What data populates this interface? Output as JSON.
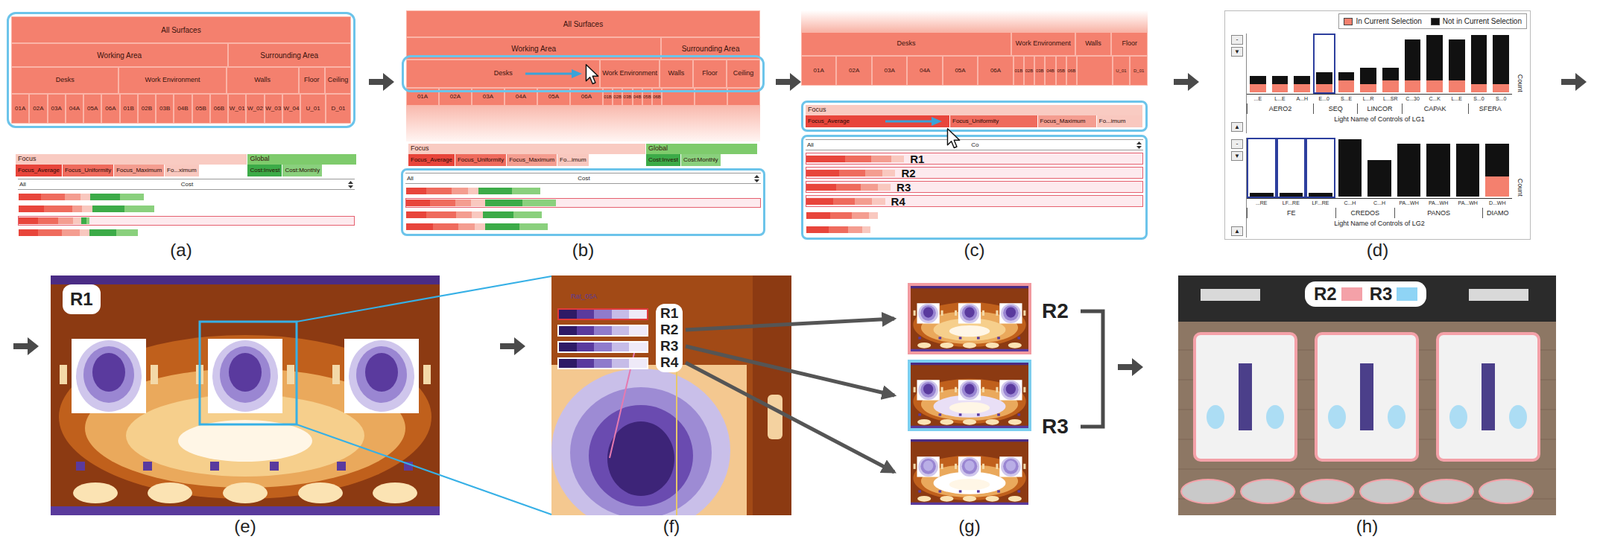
{
  "panel_labels": [
    "(a)",
    "(b)",
    "(c)",
    "(d)",
    "(e)",
    "(f)",
    "(g)",
    "(h)"
  ],
  "panel_a": {
    "treemap": {
      "highlighted_row": "all",
      "root": "All Surfaces",
      "groups": [
        {
          "name": "Working Area",
          "subgroups": [
            {
              "name": "Desks",
              "expanded": true,
              "leaves": [
                "01A",
                "02A",
                "03A",
                "04A",
                "05A",
                "06A"
              ]
            },
            {
              "name": "Work Environment",
              "expanded": true,
              "leaves": [
                "01B",
                "02B",
                "03B",
                "04B",
                "05B",
                "06B"
              ]
            }
          ]
        },
        {
          "name": "Surrounding Area",
          "subgroups": [
            {
              "name": "Walls",
              "expanded": true,
              "leaves": [
                "W_01",
                "W_02",
                "W_03",
                "W_04"
              ]
            },
            {
              "name": "Floor",
              "expanded": true,
              "leaves": [
                "U_01"
              ]
            },
            {
              "name": "Ceiling",
              "expanded": true,
              "leaves": [
                "D_01"
              ]
            }
          ]
        }
      ]
    },
    "criteria": {
      "highlighted": false,
      "groups": [
        {
          "title": "Focus",
          "color": "#f9cbc2",
          "items": [
            {
              "label": "Focus_Average",
              "weight": 0.19,
              "color": "#e8453b"
            },
            {
              "label": "Focus_Uniformity",
              "weight": 0.24,
              "color": "#ef6b5d"
            },
            {
              "label": "Focus_Maximum",
              "weight": 0.15,
              "color": "#f49d90"
            },
            {
              "label": "Fo...ximum",
              "weight": 0.1,
              "color": "#f9c8bf"
            }
          ]
        },
        {
          "title": "Global",
          "color": "#7ecb6c",
          "items": [
            {
              "label": "Cost:Invest",
              "weight": 0.16,
              "color": "#3cab48"
            },
            {
              "label": "Cost:Monthly",
              "weight": 0.16,
              "color": "#8ad07d"
            }
          ]
        }
      ]
    },
    "column_header": {
      "all": "All",
      "sort": "Cost"
    },
    "rows_highlighted": false,
    "rows": [
      {
        "values": [
          0.35,
          0.3,
          0.3,
          0.3,
          0.55,
          0.45
        ],
        "selected": false
      },
      {
        "values": [
          0.4,
          0.35,
          0.2,
          0.3,
          0.6,
          0.55
        ],
        "selected": false
      },
      {
        "values": [
          0.3,
          0.25,
          0.3,
          0.25,
          0.1,
          0.05
        ],
        "selected": true
      },
      {
        "values": [
          0.3,
          0.3,
          0.35,
          0.3,
          0.5,
          0.4
        ],
        "selected": false
      }
    ]
  },
  "panel_b": {
    "treemap": {
      "highlighted_row": "subgroups",
      "root": "All Surfaces",
      "groups": [
        {
          "name": "Working Area",
          "subgroups": [
            {
              "name": "Desks",
              "expanded": true,
              "leaves": [
                "01A",
                "02A",
                "03A",
                "04A",
                "05A",
                "06A"
              ]
            },
            {
              "name": "Work Environment",
              "expanded": false,
              "leaves": [
                "01B",
                "02B",
                "03B",
                "04B",
                "05B",
                "06B"
              ]
            }
          ]
        },
        {
          "name": "Surrounding Area",
          "subgroups": [
            {
              "name": "Walls",
              "expanded": false,
              "leaves": []
            },
            {
              "name": "Floor",
              "expanded": false,
              "leaves": []
            },
            {
              "name": "Ceiling",
              "expanded": false,
              "leaves": []
            }
          ]
        }
      ]
    },
    "criteria": {
      "highlighted": false,
      "groups": [
        {
          "title": "Focus",
          "color": "#f9cbc2",
          "items": [
            {
              "label": "Focus_Average",
              "weight": 0.19,
              "color": "#e8453b"
            },
            {
              "label": "Focus_Uniformity",
              "weight": 0.24,
              "color": "#ef6b5d"
            },
            {
              "label": "Focus_Maximum",
              "weight": 0.15,
              "color": "#f49d90"
            },
            {
              "label": "Fo...imum",
              "weight": 0.1,
              "color": "#f9c8bf"
            }
          ]
        },
        {
          "title": "Global",
          "color": "#7ecb6c",
          "items": [
            {
              "label": "Cost:Invest",
              "weight": 0.16,
              "color": "#3cab48"
            },
            {
              "label": "Cost:Monthly",
              "weight": 0.16,
              "color": "#8ad07d"
            }
          ]
        }
      ]
    },
    "column_header": {
      "all": "All",
      "sort": "Cost"
    },
    "rows_highlighted": true,
    "rows": [
      {
        "values": [
          0.3,
          0.3,
          0.3,
          0.3,
          0.6,
          0.5
        ],
        "selected": false
      },
      {
        "values": [
          0.35,
          0.3,
          0.3,
          0.4,
          0.65,
          0.6
        ],
        "selected": true
      },
      {
        "values": [
          0.3,
          0.35,
          0.3,
          0.3,
          0.55,
          0.5
        ],
        "selected": false
      },
      {
        "values": [
          0.4,
          0.3,
          0.3,
          0.3,
          0.6,
          0.5
        ],
        "selected": false
      }
    ]
  },
  "panel_c": {
    "treemap": {
      "highlighted_row": "none",
      "subgroups": [
        {
          "name": "Desks",
          "expanded": true,
          "leaves": [
            "01A",
            "02A",
            "03A",
            "04A",
            "05A",
            "06A"
          ]
        },
        {
          "name": "Work Environment",
          "expanded": false,
          "leaves": [
            "01B",
            "02B",
            "03B",
            "04B",
            "05B",
            "06B"
          ]
        },
        {
          "name": "Walls",
          "expanded": false,
          "leaves": []
        },
        {
          "name": "Floor",
          "expanded": false,
          "leaves": [
            "U_01",
            "D_01"
          ]
        }
      ]
    },
    "criteria": {
      "highlighted": true,
      "groups": [
        {
          "title": "Focus",
          "color": "#f9cbc2",
          "items": [
            {
              "label": "Focus_Average",
              "weight": 0.44,
              "color": "#e8453b"
            },
            {
              "label": "Focus_Uniformity",
              "weight": 0.26,
              "color": "#ef6b5d"
            },
            {
              "label": "Focus_Maximum",
              "weight": 0.17,
              "color": "#f49d90"
            },
            {
              "label": "Fo...imum",
              "weight": 0.13,
              "color": "#f9c8bf"
            }
          ]
        }
      ]
    },
    "column_header": {
      "all": "All",
      "sort": "Co"
    },
    "rows_highlighted": true,
    "rows": [
      {
        "label": "R1",
        "values": [
          0.26,
          0.3,
          0.35,
          0.3
        ],
        "selected": true
      },
      {
        "label": "R2",
        "values": [
          0.22,
          0.3,
          0.3,
          0.3
        ],
        "selected": true
      },
      {
        "label": "R3",
        "values": [
          0.2,
          0.28,
          0.3,
          0.3
        ],
        "selected": true
      },
      {
        "label": "R4",
        "values": [
          0.18,
          0.25,
          0.3,
          0.3
        ],
        "selected": true
      },
      {
        "values": [
          0.16,
          0.25,
          0.3,
          0.2
        ],
        "selected": false
      },
      {
        "values": [
          0.15,
          0.22,
          0.25,
          0.2
        ],
        "selected": false
      }
    ]
  },
  "panel_d": {
    "legend": [
      {
        "label": "In Current Selection",
        "color": "#f4806e"
      },
      {
        "label": "Not in Current Selection",
        "color": "#111111"
      }
    ],
    "histograms": [
      {
        "axis_title": "Light Name of Controls of LG1",
        "count_label": "Count",
        "buttons": [
          "-",
          "▼",
          "▲"
        ],
        "bars": [
          {
            "label": "...E",
            "total": 4,
            "in": 2,
            "brushed": false
          },
          {
            "label": "L...E",
            "total": 4,
            "in": 2,
            "brushed": false
          },
          {
            "label": "A...H",
            "total": 4,
            "in": 2,
            "brushed": false
          },
          {
            "label": "E...0",
            "total": 5,
            "in": 2,
            "brushed": true
          },
          {
            "label": "S...E",
            "total": 5,
            "in": 3,
            "brushed": false
          },
          {
            "label": "L...R",
            "total": 6,
            "in": 2,
            "brushed": false
          },
          {
            "label": "L...SR",
            "total": 6,
            "in": 3,
            "brushed": false
          },
          {
            "label": "C...30",
            "total": 13,
            "in": 3,
            "brushed": false
          },
          {
            "label": "C...K",
            "total": 14,
            "in": 3,
            "brushed": false
          },
          {
            "label": "L...E",
            "total": 13,
            "in": 3,
            "brushed": false
          },
          {
            "label": "S...0",
            "total": 14,
            "in": 2,
            "brushed": false
          },
          {
            "label": "S...0",
            "total": 14,
            "in": 2,
            "brushed": false
          }
        ],
        "groups": [
          {
            "name": "AERO2",
            "span": 3
          },
          {
            "name": "SEQ",
            "span": 2
          },
          {
            "name": "LINCOR",
            "span": 2
          },
          {
            "name": "CAPAK",
            "span": 3
          },
          {
            "name": "SFERA",
            "span": 2
          }
        ]
      },
      {
        "axis_title": "Light Name of Controls of LG2",
        "count_label": "Count",
        "buttons": [
          "-",
          "▼",
          "▲"
        ],
        "bars": [
          {
            "label": "...RE",
            "total": 1,
            "in": 0,
            "brushed": true
          },
          {
            "label": "LF...RE",
            "total": 1,
            "in": 0,
            "brushed": true
          },
          {
            "label": "LF...RE",
            "total": 1,
            "in": 0,
            "brushed": true
          },
          {
            "label": "C...H",
            "total": 14,
            "in": 0,
            "brushed": false
          },
          {
            "label": "C...H",
            "total": 9,
            "in": 0,
            "brushed": false
          },
          {
            "label": "PA...WH",
            "total": 13,
            "in": 0,
            "brushed": false
          },
          {
            "label": "PA...WH",
            "total": 13,
            "in": 0,
            "brushed": false
          },
          {
            "label": "PA...WH",
            "total": 13,
            "in": 0,
            "brushed": false
          },
          {
            "label": "D...WH",
            "total": 13,
            "in": 5,
            "brushed": false
          }
        ],
        "groups": [
          {
            "name": "FE",
            "span": 3
          },
          {
            "name": "CREDOS",
            "span": 2
          },
          {
            "name": "PANOS",
            "span": 3
          },
          {
            "name": "DIAMO",
            "span": 1
          }
        ]
      }
    ]
  },
  "panel_e": {
    "region_label": "R1",
    "zoom_highlight": true
  },
  "panel_f": {
    "title": "Rat_05A",
    "regions": [
      {
        "label": "R1",
        "selected": true
      },
      {
        "label": "R2",
        "selected": false
      },
      {
        "label": "R3",
        "selected": false
      },
      {
        "label": "R4",
        "selected": false
      }
    ]
  },
  "panel_g": {
    "thumbnails": [
      {
        "outlined": true,
        "color": "#f29aa0"
      },
      {
        "outlined": true,
        "color": "#7ccff0"
      },
      {
        "outlined": false
      }
    ],
    "bracket_labels": [
      "R2",
      "R3"
    ]
  },
  "panel_h": {
    "legend": [
      {
        "label": "R2",
        "color": "#f4a1a8"
      },
      {
        "label": "R3",
        "color": "#8fd4f5"
      }
    ]
  }
}
